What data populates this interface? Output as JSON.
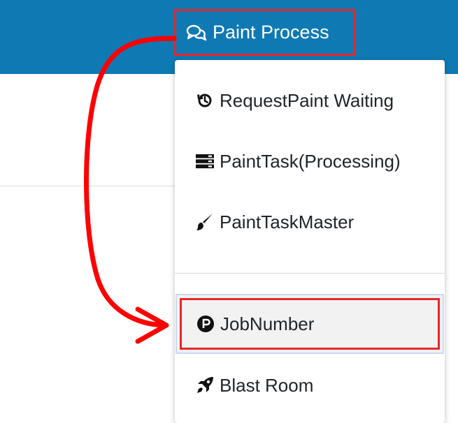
{
  "header": {
    "menu_label": "Paint Process",
    "menu_icon": "comments-icon",
    "background_color": "#0f79b4",
    "highlight_color": "#e8262a"
  },
  "dropdown": {
    "items": [
      {
        "label": "RequestPaint Waiting",
        "icon": "history-icon"
      },
      {
        "label": "PaintTask(Processing)",
        "icon": "server-icon"
      },
      {
        "label": "PaintTaskMaster",
        "icon": "paint-brush-icon"
      },
      {
        "label": "JobNumber",
        "icon": "parking-circle-icon",
        "highlighted": true
      },
      {
        "label": "Blast Room",
        "icon": "rocket-icon"
      }
    ]
  },
  "annotation": {
    "arrow_color": "#ff0000"
  }
}
